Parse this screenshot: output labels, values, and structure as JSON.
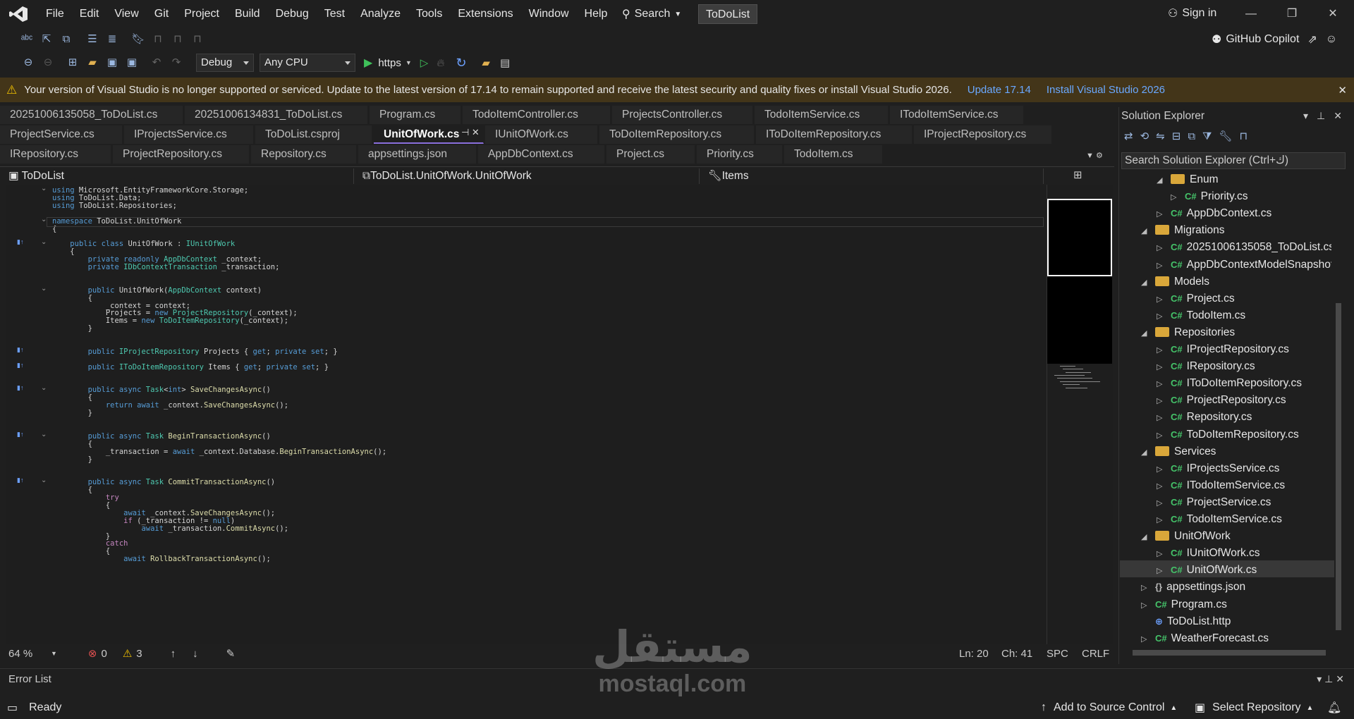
{
  "titlebar": {
    "menu": [
      "File",
      "Edit",
      "View",
      "Git",
      "Project",
      "Build",
      "Debug",
      "Test",
      "Analyze",
      "Tools",
      "Extensions",
      "Window",
      "Help"
    ],
    "search_label": "Search",
    "solution_name": "ToDoList",
    "signin": "Sign in"
  },
  "toolbar": {
    "configuration": "Debug",
    "platform": "Any CPU",
    "run_target": "https",
    "copilot": "GitHub Copilot"
  },
  "infobar": {
    "message": "Your version of Visual Studio is no longer supported or serviced. Update to the latest version of 17.14 to remain supported and receive the latest security and quality fixes or install Visual Studio 2026.",
    "link_update": "Update 17.14",
    "link_install": "Install Visual Studio 2026"
  },
  "tabs": {
    "row1": [
      "20251006135058_ToDoList.cs",
      "20251006134831_ToDoList.cs",
      "Program.cs",
      "TodoItemController.cs",
      "ProjectsController.cs",
      "TodoItemService.cs",
      "ITodoItemService.cs"
    ],
    "row2": [
      "ProjectService.cs",
      "IProjectsService.cs",
      "ToDoList.csproj",
      "UnitOfWork.cs",
      "IUnitOfWork.cs",
      "ToDoItemRepository.cs",
      "IToDoItemRepository.cs",
      "IProjectRepository.cs"
    ],
    "row3": [
      "IRepository.cs",
      "ProjectRepository.cs",
      "Repository.cs",
      "appsettings.json",
      "AppDbContext.cs",
      "Project.cs",
      "Priority.cs",
      "TodoItem.cs"
    ]
  },
  "navbar": {
    "project": "ToDoList",
    "type": "ToDoList.UnitOfWork.UnitOfWork",
    "member": "Items"
  },
  "editor_status": {
    "zoom": "64 %",
    "errors": "0",
    "warnings": "3",
    "line": "Ln: 20",
    "col": "Ch: 41",
    "spc": "SPC",
    "eol": "CRLF"
  },
  "solution_explorer": {
    "title": "Solution Explorer",
    "search_placeholder": "Search Solution Explorer (Ctrl+ك)",
    "items": [
      {
        "label": "Enum",
        "kind": "folder",
        "expanded": "◢"
      },
      {
        "label": "Priority.cs",
        "kind": "cs",
        "expanded": "▷"
      },
      {
        "label": "AppDbContext.cs",
        "kind": "cs",
        "expanded": "▷"
      },
      {
        "label": "Migrations",
        "kind": "folder",
        "expanded": "◢"
      },
      {
        "label": "20251006135058_ToDoList.cs",
        "kind": "cs",
        "expanded": "▷"
      },
      {
        "label": "AppDbContextModelSnapshot.cs",
        "kind": "cs",
        "expanded": "▷"
      },
      {
        "label": "Models",
        "kind": "folder",
        "expanded": "◢"
      },
      {
        "label": "Project.cs",
        "kind": "cs",
        "expanded": "▷"
      },
      {
        "label": "TodoItem.cs",
        "kind": "cs",
        "expanded": "▷"
      },
      {
        "label": "Repositories",
        "kind": "folder",
        "expanded": "◢"
      },
      {
        "label": "IProjectRepository.cs",
        "kind": "cs",
        "expanded": "▷"
      },
      {
        "label": "IRepository.cs",
        "kind": "cs",
        "expanded": "▷"
      },
      {
        "label": "IToDoItemRepository.cs",
        "kind": "cs",
        "expanded": "▷"
      },
      {
        "label": "ProjectRepository.cs",
        "kind": "cs",
        "expanded": "▷"
      },
      {
        "label": "Repository.cs",
        "kind": "cs",
        "expanded": "▷"
      },
      {
        "label": "ToDoItemRepository.cs",
        "kind": "cs",
        "expanded": "▷"
      },
      {
        "label": "Services",
        "kind": "folder",
        "expanded": "◢"
      },
      {
        "label": "IProjectsService.cs",
        "kind": "cs",
        "expanded": "▷"
      },
      {
        "label": "ITodoItemService.cs",
        "kind": "cs",
        "expanded": "▷"
      },
      {
        "label": "ProjectService.cs",
        "kind": "cs",
        "expanded": "▷"
      },
      {
        "label": "TodoItemService.cs",
        "kind": "cs",
        "expanded": "▷"
      },
      {
        "label": "UnitOfWork",
        "kind": "folder",
        "expanded": "◢"
      },
      {
        "label": "IUnitOfWork.cs",
        "kind": "cs",
        "expanded": "▷"
      },
      {
        "label": "UnitOfWork.cs",
        "kind": "cs",
        "expanded": "▷"
      },
      {
        "label": "appsettings.json",
        "kind": "json",
        "expanded": "▷"
      },
      {
        "label": "Program.cs",
        "kind": "cs",
        "expanded": "▷"
      },
      {
        "label": "ToDoList.http",
        "kind": "http",
        "expanded": ""
      },
      {
        "label": "WeatherForecast.cs",
        "kind": "cs",
        "expanded": "▷"
      }
    ]
  },
  "error_list": {
    "title": "Error List"
  },
  "statusbar": {
    "ready": "Ready",
    "source_control": "Add to Source Control",
    "repository": "Select Repository"
  },
  "watermark": {
    "arabic": "مستقل",
    "latin": "mostaql.com"
  },
  "code": [
    {
      "t": "using Microsoft.EntityFrameworkCore.Storage;",
      "c": "kw-first"
    },
    {
      "t": "using ToDoList.Data;",
      "c": "kw-first"
    },
    {
      "t": "using ToDoList.Repositories;",
      "c": "kw-first"
    },
    {
      "t": "",
      "c": ""
    },
    {
      "t": "namespace ToDoList.UnitOfWork",
      "c": "kw-first"
    },
    {
      "t": "{",
      "c": ""
    },
    {
      "t": "",
      "c": ""
    },
    {
      "t": "    public class UnitOfWork : IUnitOfWork",
      "c": ""
    },
    {
      "t": "    {",
      "c": ""
    },
    {
      "t": "        private readonly AppDbContext _context;",
      "c": ""
    },
    {
      "t": "        private IDbContextTransaction _transaction;",
      "c": ""
    },
    {
      "t": "",
      "c": ""
    },
    {
      "t": "",
      "c": ""
    },
    {
      "t": "        public UnitOfWork(AppDbContext context)",
      "c": ""
    },
    {
      "t": "        {",
      "c": ""
    },
    {
      "t": "            _context = context;",
      "c": ""
    },
    {
      "t": "            Projects = new ProjectRepository(_context);",
      "c": ""
    },
    {
      "t": "            Items = new ToDoItemRepository(_context);",
      "c": ""
    },
    {
      "t": "        }",
      "c": ""
    },
    {
      "t": "",
      "c": ""
    },
    {
      "t": "",
      "c": ""
    },
    {
      "t": "        public IProjectRepository Projects { get; private set; }",
      "c": ""
    },
    {
      "t": "",
      "c": ""
    },
    {
      "t": "        public IToDoItemRepository Items { get; private set; }",
      "c": ""
    },
    {
      "t": "",
      "c": ""
    },
    {
      "t": "",
      "c": ""
    },
    {
      "t": "        public async Task<int> SaveChangesAsync()",
      "c": ""
    },
    {
      "t": "        {",
      "c": ""
    },
    {
      "t": "            return await _context.SaveChangesAsync();",
      "c": ""
    },
    {
      "t": "        }",
      "c": ""
    },
    {
      "t": "",
      "c": ""
    },
    {
      "t": "",
      "c": ""
    },
    {
      "t": "        public async Task BeginTransactionAsync()",
      "c": ""
    },
    {
      "t": "        {",
      "c": ""
    },
    {
      "t": "            _transaction = await _context.Database.BeginTransactionAsync();",
      "c": ""
    },
    {
      "t": "        }",
      "c": ""
    },
    {
      "t": "",
      "c": ""
    },
    {
      "t": "",
      "c": ""
    },
    {
      "t": "        public async Task CommitTransactionAsync()",
      "c": ""
    },
    {
      "t": "        {",
      "c": ""
    },
    {
      "t": "            try",
      "c": ""
    },
    {
      "t": "            {",
      "c": ""
    },
    {
      "t": "                await _context.SaveChangesAsync();",
      "c": ""
    },
    {
      "t": "                if (_transaction != null)",
      "c": ""
    },
    {
      "t": "                    await _transaction.CommitAsync();",
      "c": ""
    },
    {
      "t": "            }",
      "c": ""
    },
    {
      "t": "            catch",
      "c": ""
    },
    {
      "t": "            {",
      "c": ""
    },
    {
      "t": "                await RollbackTransactionAsync();",
      "c": ""
    }
  ]
}
